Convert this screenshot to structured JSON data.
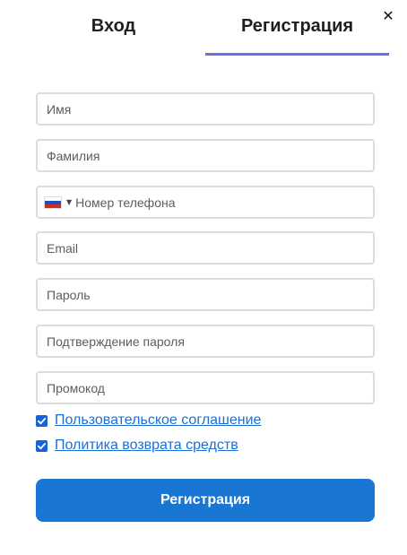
{
  "close": {
    "icon": "close-icon",
    "glyph": "✕"
  },
  "tabs": [
    {
      "label": "Вход",
      "active": false
    },
    {
      "label": "Регистрация",
      "active": true
    }
  ],
  "form": {
    "first_name": {
      "placeholder": "Имя",
      "value": ""
    },
    "last_name": {
      "placeholder": "Фамилия",
      "value": ""
    },
    "phone": {
      "placeholder": "Номер телефона",
      "value": "",
      "country_flag": "russia-flag-icon",
      "caret": "▼"
    },
    "email": {
      "placeholder": "Email",
      "value": ""
    },
    "password": {
      "placeholder": "Пароль",
      "value": ""
    },
    "password_confirm": {
      "placeholder": "Подтверждение пароля",
      "value": ""
    },
    "promo": {
      "placeholder": "Промокод",
      "value": ""
    }
  },
  "agreements": [
    {
      "label": "Пользовательское соглашение",
      "checked": true
    },
    {
      "label": "Политика возврата средств",
      "checked": true
    }
  ],
  "submit_label": "Регистрация",
  "colors": {
    "accent_tab": "#6b6ee6",
    "button": "#1976d2",
    "link": "#1a6fd6",
    "checkbox": "#1565d8"
  }
}
